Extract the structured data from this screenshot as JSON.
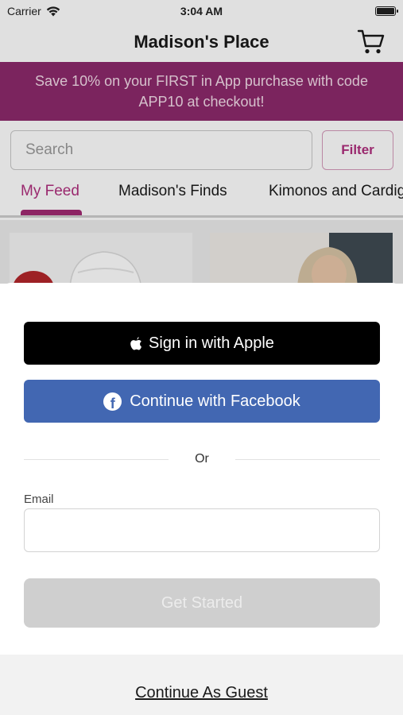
{
  "status_bar": {
    "carrier": "Carrier",
    "time": "3:04 AM"
  },
  "header": {
    "title": "Madison's Place"
  },
  "promo": {
    "line1": "Save 10% on your FIRST in App purchase with code",
    "line2": "APP10 at checkout!"
  },
  "search": {
    "placeholder": "Search",
    "filter_label": "Filter"
  },
  "tabs": [
    {
      "label": "My Feed",
      "active": true
    },
    {
      "label": "Madison's Finds",
      "active": false
    },
    {
      "label": "Kimonos and Cardigans",
      "active": false
    }
  ],
  "auth": {
    "apple_label": "Sign in with Apple",
    "facebook_label": "Continue with Facebook",
    "or_text": "Or",
    "email_label": "Email",
    "email_value": "",
    "get_started_label": "Get Started",
    "guest_label": "Continue As Guest"
  },
  "colors": {
    "brand": "#8c2a6c",
    "accent": "#b02f7e",
    "facebook": "#4267b2",
    "apple": "#000000",
    "disabled": "#cfcfcf"
  }
}
